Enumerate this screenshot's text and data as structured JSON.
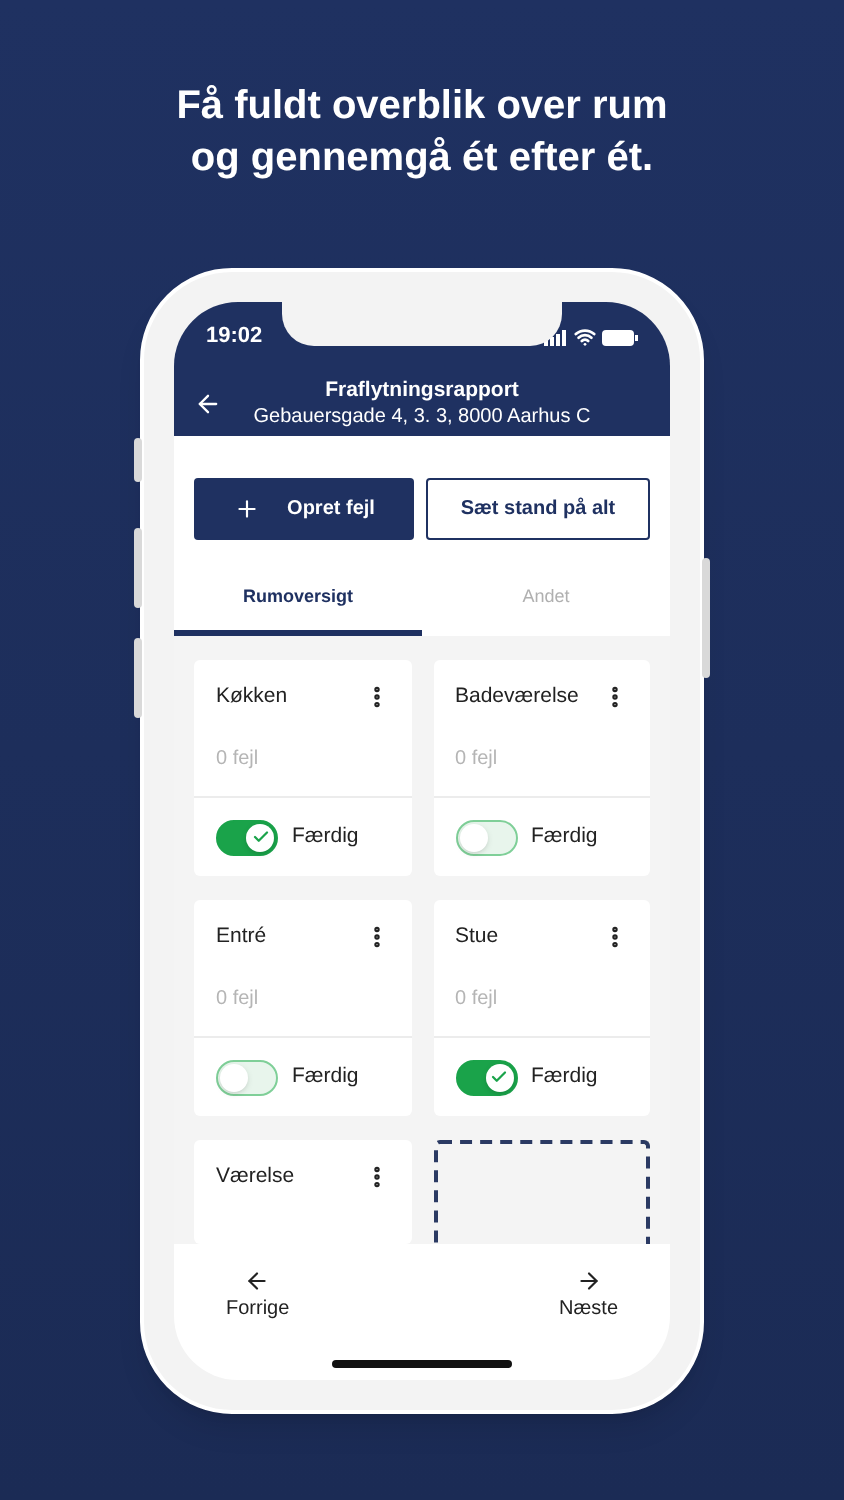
{
  "headline": "Få fuldt overblik over rum og gennemgå ét efter ét.",
  "status_bar": {
    "time": "19:02"
  },
  "header": {
    "title": "Fraflytningsrapport",
    "address": "Gebauersgade 4, 3. 3, 8000 Aarhus C"
  },
  "actions": [
    {
      "label": "Opret fejl",
      "kind": "primary"
    },
    {
      "label": "Sæt stand på alt",
      "kind": "outline"
    }
  ],
  "tabs": [
    {
      "label": "Rumoversigt",
      "selected": true
    },
    {
      "label": "Andet",
      "selected": false
    }
  ],
  "rooms": [
    {
      "kind": "room",
      "name": "Køkken",
      "errors": "0 fejl",
      "status": "Færdig",
      "done": true
    },
    {
      "kind": "room",
      "name": "Badeværelse",
      "errors": "0 fejl",
      "status": "Færdig",
      "done": false
    },
    {
      "kind": "room",
      "name": "Entré",
      "errors": "0 fejl",
      "status": "Færdig",
      "done": false
    },
    {
      "kind": "room",
      "name": "Stue",
      "errors": "0 fejl",
      "status": "Færdig",
      "done": true
    },
    {
      "kind": "room",
      "name": "Værelse"
    },
    {
      "kind": "add"
    }
  ],
  "bottom_nav": {
    "previous": "Forrige",
    "next": "Næste"
  }
}
